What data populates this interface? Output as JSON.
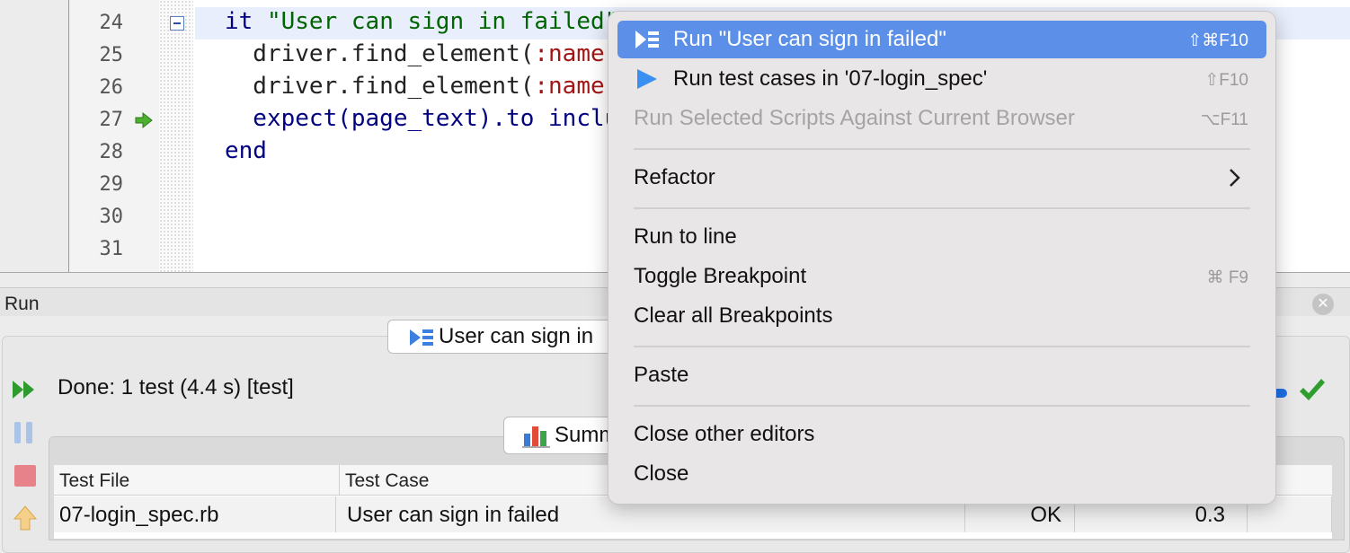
{
  "editor": {
    "lines": [
      {
        "num": "24",
        "segments": [
          {
            "t": "it ",
            "c": "kw"
          },
          {
            "t": "\"User can sign in failed\"",
            "c": "str"
          }
        ]
      },
      {
        "num": "25",
        "segments": [
          {
            "t": "  driver.find_element(",
            "c": ""
          },
          {
            "t": ":name",
            "c": "sym"
          }
        ]
      },
      {
        "num": "26",
        "segments": [
          {
            "t": "  driver.find_element(",
            "c": ""
          },
          {
            "t": ":name",
            "c": "sym"
          }
        ]
      },
      {
        "num": "27",
        "segments": [
          {
            "t": "  expect(page_text).to ",
            "c": "meth"
          },
          {
            "t": "inclu",
            "c": "meth"
          }
        ]
      },
      {
        "num": "28",
        "segments": [
          {
            "t": "end",
            "c": "kw"
          }
        ]
      },
      {
        "num": "29",
        "segments": []
      },
      {
        "num": "30",
        "segments": []
      },
      {
        "num": "31",
        "segments": []
      }
    ]
  },
  "run_panel": {
    "title": "Run",
    "test_tab_label": "User can sign in",
    "status_text": "Done: 1 test (4.4 s) [test]",
    "summary_tab_label": "Summ",
    "table": {
      "headers": [
        "Test File",
        "Test Case"
      ],
      "rows": [
        {
          "file": "07-login_spec.rb",
          "case": "User can sign in failed",
          "result": "OK",
          "time": "0.3"
        }
      ]
    }
  },
  "context_menu": {
    "items": [
      {
        "label": "Run \"User can sign in failed\"",
        "shortcut": "⇧⌘F10",
        "state": "selected",
        "icon": "run-test-icon"
      },
      {
        "label": "Run test cases in '07-login_spec'",
        "shortcut": "⇧F10",
        "state": "enabled",
        "icon": "play-icon"
      },
      {
        "label": "Run Selected Scripts Against Current Browser",
        "shortcut": "⌥F11",
        "state": "disabled"
      },
      {
        "separator": true
      },
      {
        "label": "Refactor",
        "submenu": true,
        "state": "enabled"
      },
      {
        "separator": true
      },
      {
        "label": "Run to line",
        "shortcut": "",
        "state": "enabled"
      },
      {
        "label": "Toggle Breakpoint",
        "shortcut": "⌘ F9",
        "state": "enabled"
      },
      {
        "label": "Clear all Breakpoints",
        "shortcut": "",
        "state": "enabled"
      },
      {
        "separator": true
      },
      {
        "label": "Paste",
        "shortcut": "",
        "state": "enabled"
      },
      {
        "separator": true
      },
      {
        "label": "Close other editors",
        "shortcut": "",
        "state": "enabled"
      },
      {
        "label": "Close",
        "shortcut": "",
        "state": "enabled"
      }
    ]
  },
  "colors": {
    "menu_highlight": "#5b8fe8",
    "keyword": "#000080",
    "string": "#006400",
    "symbol": "#a31515",
    "pass_green": "#2e9e2e"
  }
}
